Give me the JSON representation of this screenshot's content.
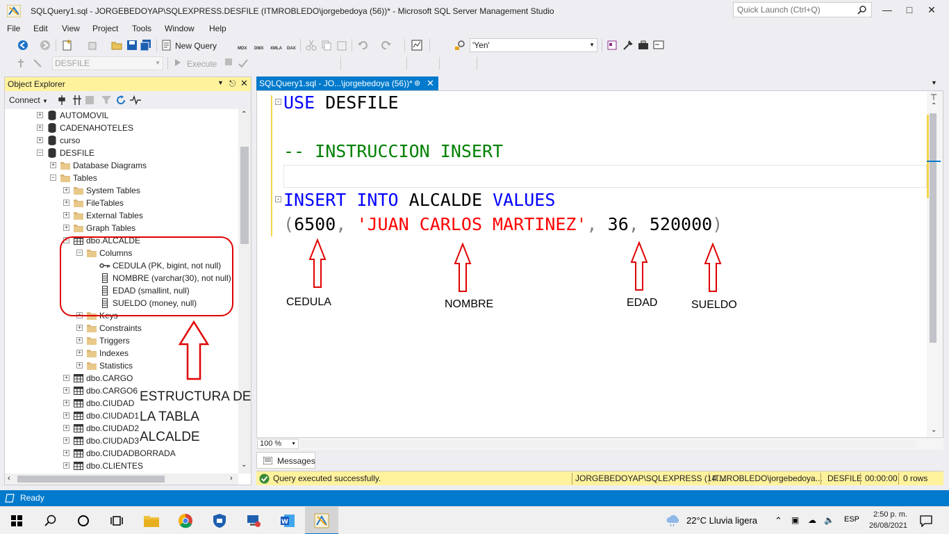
{
  "window": {
    "title": "SQLQuery1.sql - JORGEBEDOYAP\\SQLEXPRESS.DESFILE (ITMROBLEDO\\jorgebedoya (56))* - Microsoft SQL Server Management Studio",
    "quick_launch_placeholder": "Quick Launch (Ctrl+Q)"
  },
  "menu": [
    "File",
    "Edit",
    "View",
    "Project",
    "Tools",
    "Window",
    "Help"
  ],
  "toolbar": {
    "new_query_label": "New Query",
    "search_combo_value": "'Yen'",
    "database_combo_value": "DESFILE",
    "execute_label": "Execute",
    "small_labels": [
      "MDX",
      "DMX",
      "XMLA",
      "DAX"
    ]
  },
  "object_explorer": {
    "title": "Object Explorer",
    "connect_label": "Connect",
    "tree": [
      {
        "label": "AUTOMOVIL",
        "icon": "database-icon",
        "expander": "+"
      },
      {
        "label": "CADENAHOTELES",
        "icon": "database-icon",
        "expander": "+"
      },
      {
        "label": "curso",
        "icon": "database-icon",
        "expander": "+"
      },
      {
        "label": "DESFILE",
        "icon": "database-icon",
        "expander": "-"
      },
      {
        "label": "Database Diagrams",
        "icon": "folder-icon",
        "expander": "+"
      },
      {
        "label": "Tables",
        "icon": "folder-icon",
        "expander": "-"
      },
      {
        "label": "System Tables",
        "icon": "folder-icon",
        "expander": "+"
      },
      {
        "label": "FileTables",
        "icon": "folder-icon",
        "expander": "+"
      },
      {
        "label": "External Tables",
        "icon": "folder-icon",
        "expander": "+"
      },
      {
        "label": "Graph Tables",
        "icon": "folder-icon",
        "expander": "+"
      },
      {
        "label": "dbo.ALCALDE",
        "icon": "table-icon",
        "expander": "-"
      },
      {
        "label": "Columns",
        "icon": "folder-icon",
        "expander": "-"
      },
      {
        "label": "CEDULA (PK, bigint, not null)",
        "icon": "key-icon",
        "expander": ""
      },
      {
        "label": "NOMBRE (varchar(30), not null)",
        "icon": "column-icon",
        "expander": ""
      },
      {
        "label": "EDAD (smallint, null)",
        "icon": "column-icon",
        "expander": ""
      },
      {
        "label": "SUELDO (money, null)",
        "icon": "column-icon",
        "expander": ""
      },
      {
        "label": "Keys",
        "icon": "folder-icon",
        "expander": "+"
      },
      {
        "label": "Constraints",
        "icon": "folder-icon",
        "expander": "+"
      },
      {
        "label": "Triggers",
        "icon": "folder-icon",
        "expander": "+"
      },
      {
        "label": "Indexes",
        "icon": "folder-icon",
        "expander": "+"
      },
      {
        "label": "Statistics",
        "icon": "folder-icon",
        "expander": "+"
      },
      {
        "label": "dbo.CARGO",
        "icon": "table-icon",
        "expander": "+"
      },
      {
        "label": "dbo.CARGO6",
        "icon": "table-icon",
        "expander": "+"
      },
      {
        "label": "dbo.CIUDAD",
        "icon": "table-icon",
        "expander": "+"
      },
      {
        "label": "dbo.CIUDAD1",
        "icon": "table-icon",
        "expander": "+"
      },
      {
        "label": "dbo.CIUDAD2",
        "icon": "table-icon",
        "expander": "+"
      },
      {
        "label": "dbo.CIUDAD3",
        "icon": "table-icon",
        "expander": "+"
      },
      {
        "label": "dbo.CIUDADBORRADA",
        "icon": "table-icon",
        "expander": "+"
      },
      {
        "label": "dbo.CLIENTES",
        "icon": "table-icon",
        "expander": "+"
      }
    ],
    "annotation_lines": [
      "ESTRUCTURA DE",
      "LA TABLA",
      "ALCALDE"
    ]
  },
  "editor": {
    "tab_label": "SQLQuery1.sql - JO...\\jorgebedoya (56))*",
    "line1": {
      "kw": "USE",
      "rest": " DESFILE"
    },
    "comment": "-- INSTRUCCION INSERT",
    "line3": {
      "kw1": "INSERT",
      "kw2": "INTO",
      "table": "ALCALDE",
      "kw3": "VALUES"
    },
    "line4": {
      "open": "(",
      "v1": "6500",
      "c1": ", ",
      "v2": "'JUAN CARLOS MARTINEZ'",
      "c2": ", ",
      "v3": "36",
      "c3": ", ",
      "v4": "520000",
      "close": ")"
    },
    "annotations": [
      "CEDULA",
      "NOMBRE",
      "EDAD",
      "SUELDO"
    ],
    "zoom": "100 %"
  },
  "results": {
    "messages_tab": "Messages",
    "status_text": "Query executed successfully.",
    "server": "JORGEBEDOYAP\\SQLEXPRESS (14....",
    "user": "ITMROBLEDO\\jorgebedoya...",
    "database": "DESFILE",
    "elapsed": "00:00:00",
    "rows": "0 rows"
  },
  "statusbar": {
    "text": "Ready"
  },
  "taskbar": {
    "weather": "22°C  Lluvia ligera",
    "language": "ESP",
    "time": "2:50 p. m.",
    "date": "26/08/2021"
  },
  "colors": {
    "accent": "#007acc",
    "highlight_yellow": "#fff29d",
    "annotation_red": "#e00000"
  }
}
